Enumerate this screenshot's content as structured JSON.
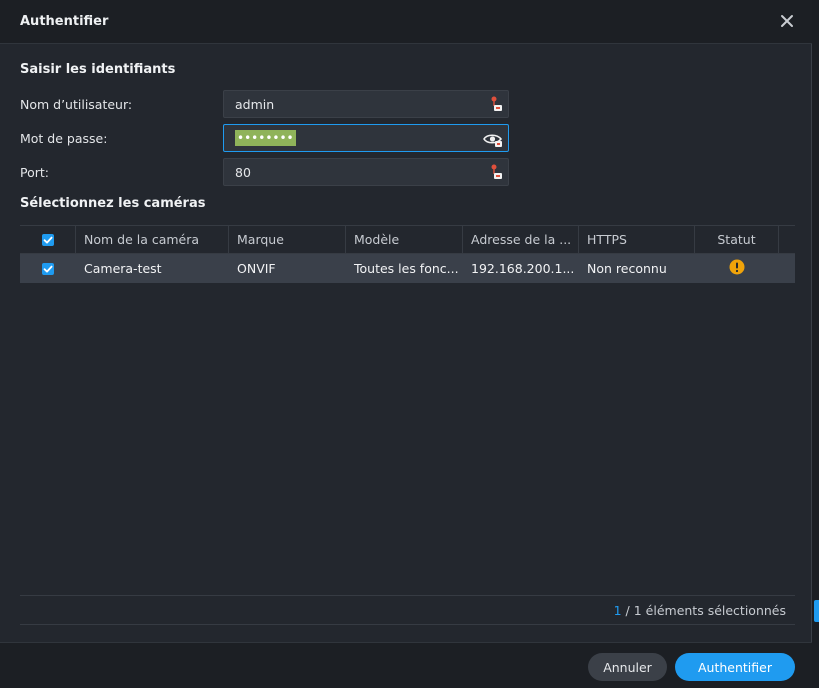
{
  "dialog": {
    "title": "Authentifier"
  },
  "credentials": {
    "section_title": "Saisir les identifiants",
    "username_label": "Nom d’utilisateur:",
    "username_value": "admin",
    "password_label": "Mot de passe:",
    "password_mask": "••••••••",
    "port_label": "Port:",
    "port_value": "80"
  },
  "cameras": {
    "section_title": "Sélectionnez les caméras",
    "columns": [
      "Nom de la caméra",
      "Marque",
      "Modèle",
      "Adresse de la ...",
      "HTTPS",
      "Statut"
    ],
    "rows": [
      {
        "name": "Camera-test",
        "brand": "ONVIF",
        "model": "Toutes les fonc...",
        "address": "192.168.200.1...",
        "https": "Non reconnu",
        "status_icon": "warning-icon",
        "checked": true
      }
    ],
    "selected_count": "1",
    "selected_suffix": "/ 1 éléments sélectionnés"
  },
  "buttons": {
    "cancel": "Annuler",
    "confirm": "Authentifier"
  },
  "colors": {
    "accent": "#1f9bf0",
    "warning": "#f0a30a",
    "autofill": "#8fb35a"
  }
}
